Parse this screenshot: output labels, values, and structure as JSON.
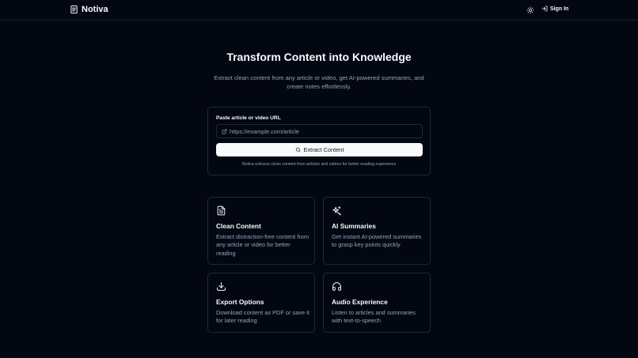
{
  "header": {
    "brand": "Notiva",
    "sign_in_label": "Sign In",
    "icons": {
      "logo": "document-icon",
      "theme": "sun-icon",
      "sign_in": "login-icon"
    }
  },
  "hero": {
    "title": "Transform Content into Knowledge",
    "subtitle": "Extract clean content from any article or video, get AI-powered summaries, and create notes effortlessly."
  },
  "url_form": {
    "label": "Paste article or video URL",
    "value": "",
    "placeholder": "https://example.com/article",
    "button_label": "Extract Content",
    "help_text": "Notiva extracts clean content from articles and videos for better reading experience",
    "icons": {
      "input": "external-link-icon",
      "button": "search-icon"
    }
  },
  "features": [
    {
      "icon": "file-text-icon",
      "title": "Clean Content",
      "description": "Extract distraction-free content from any article or video for better reading"
    },
    {
      "icon": "sparkles-icon",
      "title": "AI Summaries",
      "description": "Get instant AI-powered summaries to grasp key points quickly"
    },
    {
      "icon": "download-icon",
      "title": "Export Options",
      "description": "Download content as PDF or save it for later reading"
    },
    {
      "icon": "headphones-icon",
      "title": "Audio Experience",
      "description": "Listen to articles and summaries with text-to-speech"
    }
  ],
  "colors": {
    "background": "#030712",
    "foreground": "#f8fafc",
    "muted_text": "#94a3b8",
    "border": "#1f2937",
    "button_bg": "#f8fafc",
    "button_text": "#0f172a"
  }
}
